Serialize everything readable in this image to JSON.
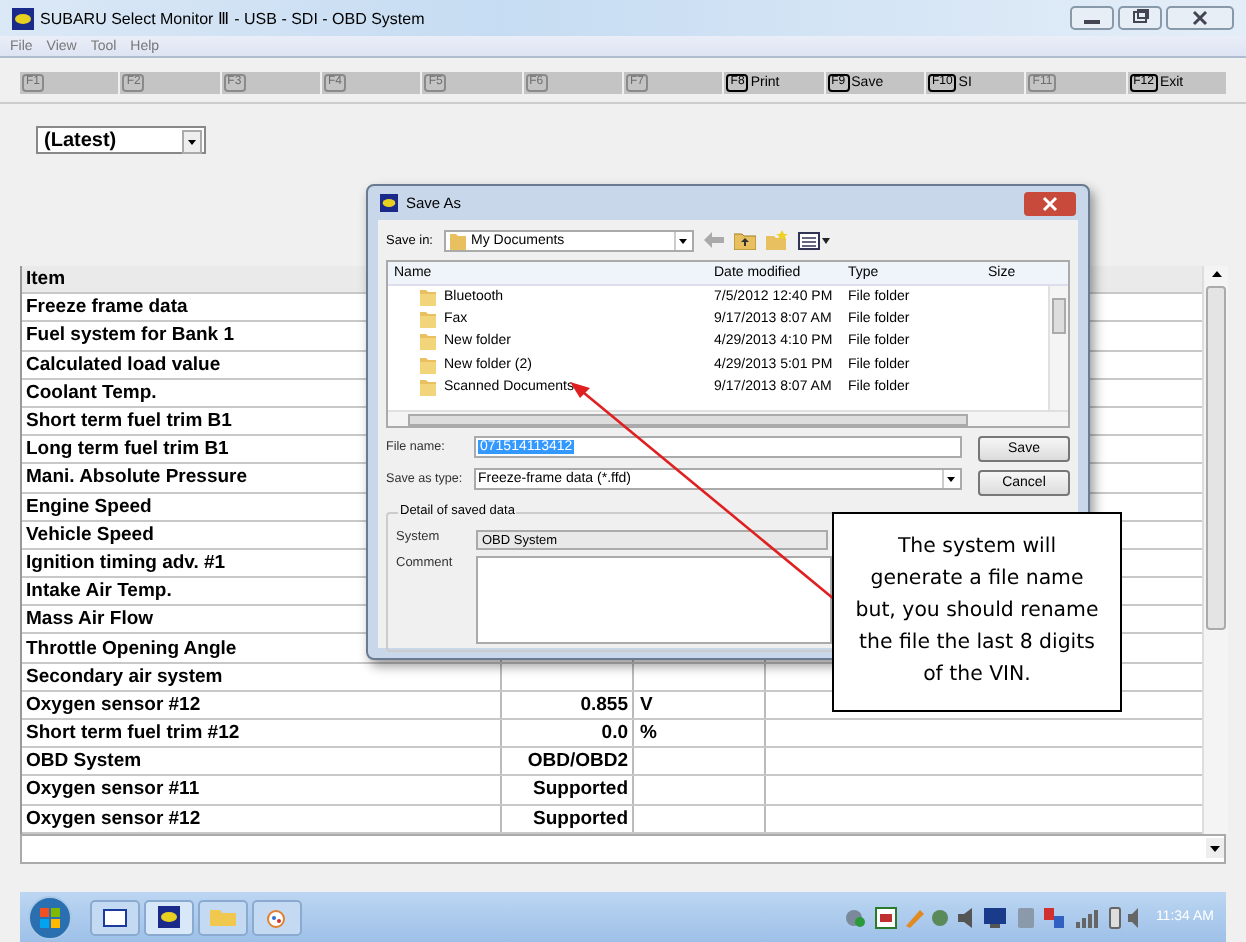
{
  "window": {
    "title": "SUBARU Select Monitor Ⅲ - USB - SDI - OBD System"
  },
  "menu": [
    "File",
    "View",
    "Tool",
    "Help"
  ],
  "function_keys": [
    {
      "key": "F1",
      "disabled": true
    },
    {
      "key": "F2",
      "disabled": true
    },
    {
      "key": "F3",
      "disabled": true
    },
    {
      "key": "F4",
      "disabled": true
    },
    {
      "key": "F5",
      "disabled": true
    },
    {
      "key": "F6",
      "disabled": true
    },
    {
      "key": "F7",
      "disabled": true
    },
    {
      "key": "F8",
      "label": "Print",
      "disabled": false
    },
    {
      "key": "F9",
      "label": "Save",
      "disabled": false
    },
    {
      "key": "F10",
      "label": "SI",
      "disabled": false
    },
    {
      "key": "F11",
      "disabled": true
    },
    {
      "key": "F12",
      "label": "Exit",
      "disabled": false
    }
  ],
  "history_select": {
    "value": "(Latest)"
  },
  "table": {
    "columns": [
      "Item"
    ],
    "rows": [
      {
        "item": "Freeze frame data"
      },
      {
        "item": "Fuel system for Bank 1"
      },
      {
        "item": "Calculated load value"
      },
      {
        "item": "Coolant Temp."
      },
      {
        "item": "Short term fuel trim B1"
      },
      {
        "item": "Long term fuel trim B1"
      },
      {
        "item": "Mani. Absolute Pressure"
      },
      {
        "item": "Engine Speed"
      },
      {
        "item": "Vehicle Speed"
      },
      {
        "item": "Ignition timing adv. #1"
      },
      {
        "item": "Intake Air Temp."
      },
      {
        "item": "Mass Air Flow"
      },
      {
        "item": "Throttle Opening Angle"
      },
      {
        "item": "Secondary air system"
      },
      {
        "item": "Oxygen sensor #12",
        "value": "0.855",
        "unit": "V"
      },
      {
        "item": "Short term fuel trim #12",
        "value": "0.0",
        "unit": "%"
      },
      {
        "item": "OBD System",
        "value": "OBD/OBD2"
      },
      {
        "item": "Oxygen sensor #11",
        "value": "Supported"
      },
      {
        "item": "Oxygen sensor #12",
        "value": "Supported"
      }
    ]
  },
  "dialog": {
    "title": "Save As",
    "save_in_label": "Save in:",
    "save_in": "My Documents",
    "columns": [
      "Name",
      "Date modified",
      "Type",
      "Size"
    ],
    "files": [
      {
        "name": "Bluetooth",
        "date": "7/5/2012 12:40 PM",
        "type": "File folder"
      },
      {
        "name": "Fax",
        "date": "9/17/2013 8:07 AM",
        "type": "File folder"
      },
      {
        "name": "New folder",
        "date": "4/29/2013 4:10 PM",
        "type": "File folder"
      },
      {
        "name": "New folder (2)",
        "date": "4/29/2013 5:01 PM",
        "type": "File folder"
      },
      {
        "name": "Scanned Documents",
        "date": "9/17/2013 8:07 AM",
        "type": "File folder"
      }
    ],
    "file_name_label": "File name:",
    "file_name": "071514113412",
    "save_type_label": "Save as type:",
    "save_type": "Freeze-frame data (*.ffd)",
    "buttons": [
      "Save",
      "Cancel"
    ],
    "details": {
      "title": "Detail of saved data",
      "system_label": "System",
      "system": "OBD System",
      "comment_label": "Comment"
    }
  },
  "callout": {
    "text": "The system will generate a file name but, you should rename the file the last 8 digits of the VIN."
  },
  "taskbar": {
    "time": "11:34 AM"
  }
}
